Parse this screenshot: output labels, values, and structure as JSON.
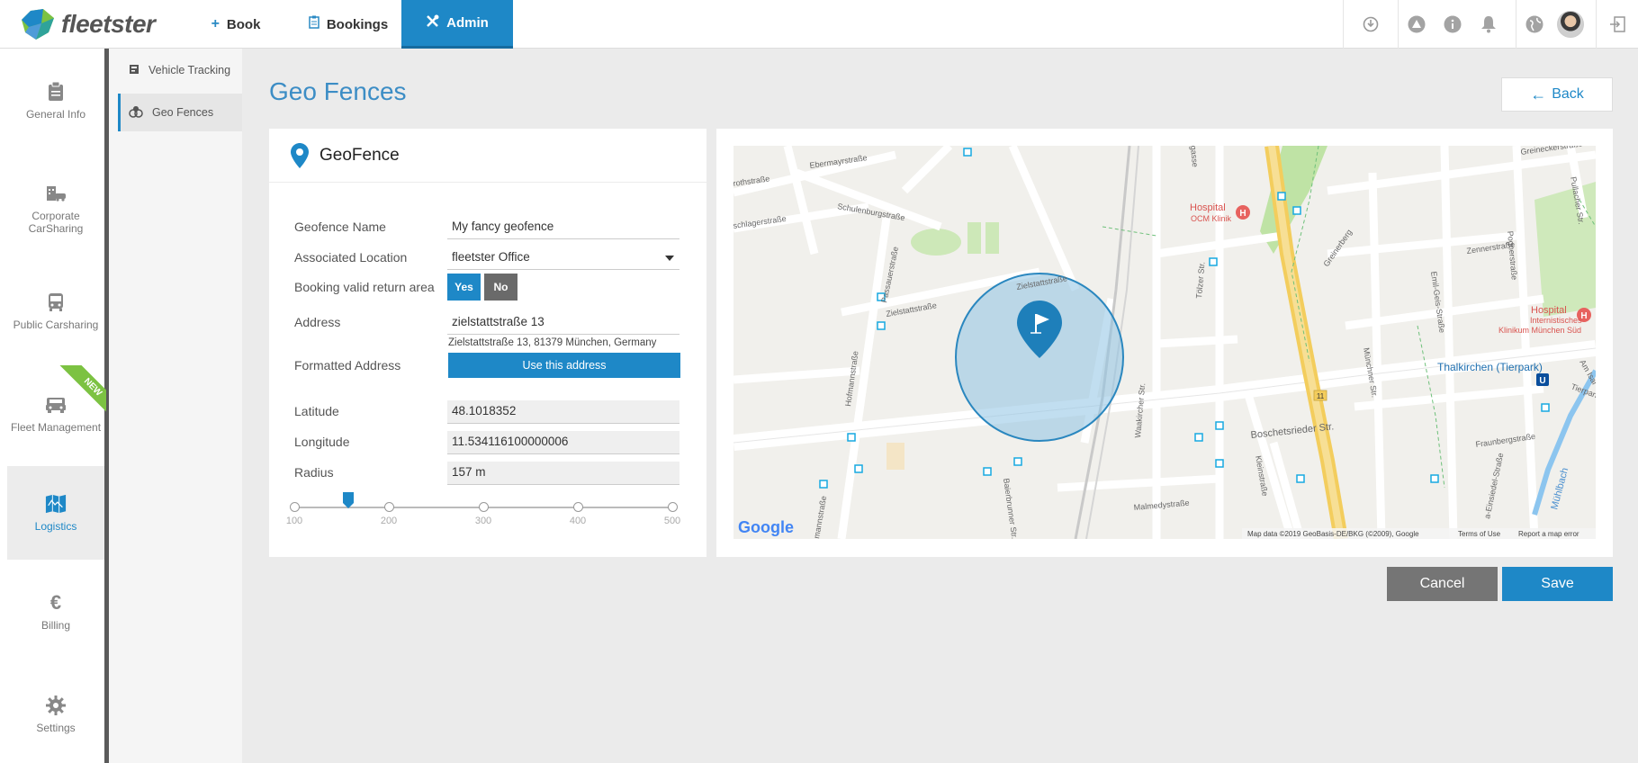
{
  "app": {
    "logo_text": "fleetster"
  },
  "topnav": [
    {
      "label": "Book",
      "icon": "plus-icon"
    },
    {
      "label": "Bookings",
      "icon": "clipboard-icon"
    },
    {
      "label": "Admin",
      "icon": "tools-icon"
    }
  ],
  "top_icons": [
    "power-icon",
    "warning-icon",
    "info-icon",
    "bell-icon",
    "globe-icon",
    "avatar",
    "logout-icon"
  ],
  "sidebar": {
    "items": [
      {
        "label": "General Info",
        "icon": "clipboard-icon"
      },
      {
        "label": "Corporate CarSharing",
        "icon": "building-car-icon"
      },
      {
        "label": "Public Carsharing",
        "icon": "bus-icon"
      },
      {
        "label": "Fleet Management",
        "icon": "car-front-icon"
      },
      {
        "label": "Logistics",
        "icon": "map-icon"
      },
      {
        "label": "Billing",
        "icon": "euro-icon"
      },
      {
        "label": "Settings",
        "icon": "gear-icon"
      }
    ],
    "new_badge": "NEW"
  },
  "subsidebar": {
    "items": [
      {
        "label": "Vehicle Tracking",
        "icon": "tracking-icon"
      },
      {
        "label": "Geo Fences",
        "icon": "geofence-icon"
      }
    ]
  },
  "page": {
    "title": "Geo Fences",
    "back_label": "Back"
  },
  "form": {
    "card_title": "GeoFence",
    "name_label": "Geofence Name",
    "name_value": "My fancy geofence",
    "location_label": "Associated Location",
    "location_value": "fleetster Office",
    "return_area_label": "Booking valid return area",
    "yes_label": "Yes",
    "no_label": "No",
    "address_label": "Address",
    "address_value": "zielstattstraße 13",
    "formatted_label": "Formatted Address",
    "formatted_value": "Zielstattstraße 13, 81379 München, Germany",
    "use_address_label": "Use this address",
    "latitude_label": "Latitude",
    "latitude_value": "48.1018352",
    "longitude_label": "Longitude",
    "longitude_value": "11.534116100000006",
    "radius_label": "Radius",
    "radius_value": "157 m",
    "slider": {
      "min": 100,
      "max": 500,
      "value": 157,
      "ticks": [
        "100",
        "200",
        "300",
        "400",
        "500"
      ]
    }
  },
  "map": {
    "labels": {
      "ebermayr": "Ebermayrstraße",
      "schulenburg": "Schulenburgstraße",
      "frotthstr": "rothstraße",
      "schlager": "schlagerstraße",
      "passauer": "Passauerstraße",
      "zielstatt1": "Zielstattstraße",
      "zielstatt2": "Zielstattstraße",
      "hofmann": "Hofmannstraße",
      "waakircher": "Waakircher Str.",
      "toelzer": "Tölzer Str.",
      "boschets": "Boschetsrieder Str.",
      "baierbrunner": "Baierbrunner Str.",
      "malmedy": "Malmedystraße",
      "kleinstr": "Kleinstraße",
      "muenchner": "Münchner Str.",
      "greinerberg": "Greinerberg",
      "emilgeis": "Emil-Geis-Straße",
      "pognerstr": "Pognerstraße",
      "zennerstr": "Zennerstraße",
      "greinecker": "Greineckerstraße",
      "pullacher": "Pullacher Str.",
      "fraunberg": "Fraunbergstraße",
      "einsiedel": "a-Einsiedel-Straße",
      "muehlbach": "Mühlbach",
      "tierpark": "Tierparkstr.",
      "amisar": "Am Isar",
      "hofmann2": "mannstraße",
      "hospital1": "Hospital",
      "hospital1_sub": "OCM Klinik",
      "hospital2": "Hospital",
      "hospital2_sub1": "Internistisches",
      "hospital2_sub2": "Klinikum München Süd",
      "thalkirchen": "Thalkirchen (Tierpark)",
      "road_num": "11",
      "google": "Google",
      "attribution": "Map data ©2019 GeoBasis-DE/BKG (©2009), Google",
      "terms": "Terms of Use",
      "report": "Report a map error",
      "gasse": "gasse"
    },
    "colors": {
      "fence_fill": "#8ec2e4",
      "fence_stroke": "#2a87bf",
      "road_major": "#f5d66b",
      "park": "#bfe3a5"
    }
  },
  "actions": {
    "cancel_label": "Cancel",
    "save_label": "Save"
  }
}
